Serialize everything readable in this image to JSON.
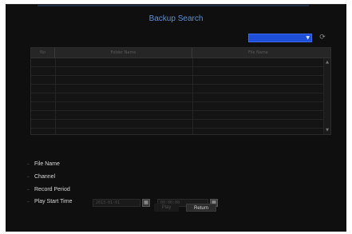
{
  "dialog": {
    "title": "Backup Search"
  },
  "device_select": {
    "value": ""
  },
  "table": {
    "columns": [
      "No",
      "Folder Name",
      "File Name"
    ],
    "rows": 9
  },
  "info": {
    "file_name_label": "File Name",
    "channel_label": "Channel",
    "record_period_label": "Record Period",
    "play_start_time_label": "Play Start Time",
    "play_start_date": "2013-01-01",
    "play_start_clock": "00:00:00"
  },
  "buttons": {
    "play": "Play",
    "return": "Return"
  },
  "colors": {
    "dialog_bg": "#0f0f0f",
    "title": "#5b8fd6",
    "dropdown": "#1e4fd8"
  },
  "icons": {
    "refresh": "refresh-icon",
    "calendar": "calendar-icon",
    "dropdown": "chevron-down-icon"
  }
}
